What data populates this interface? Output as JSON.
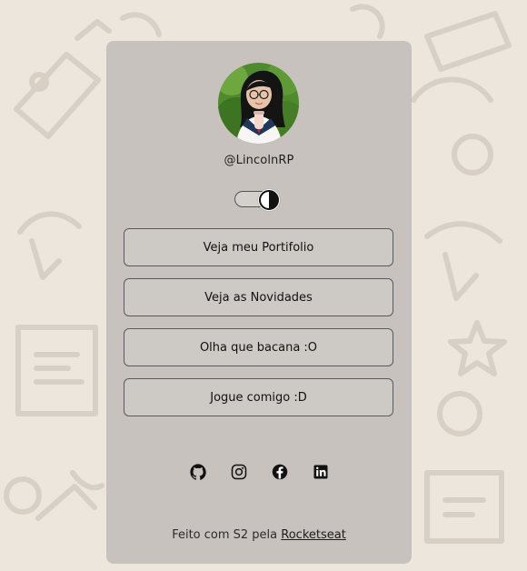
{
  "profile": {
    "username": "@LincolnRP",
    "avatar": "portrait-avatar"
  },
  "theme_toggle": {
    "icon": "half-circle-contrast-icon"
  },
  "links": [
    {
      "label": "Veja meu Portifolio"
    },
    {
      "label": "Veja as Novidades"
    },
    {
      "label": "Olha que bacana :O"
    },
    {
      "label": "Jogue comigo :D"
    }
  ],
  "social": [
    "github-icon",
    "instagram-icon",
    "facebook-icon",
    "linkedin-icon"
  ],
  "footer": {
    "text_prefix": "Feito com S2 pela ",
    "link_text": "Rocketseat"
  },
  "colors": {
    "background": "#ece6dd",
    "card": "#b8b4b0",
    "button_border": "#5a5a5a",
    "text": "#1f1f1f"
  }
}
